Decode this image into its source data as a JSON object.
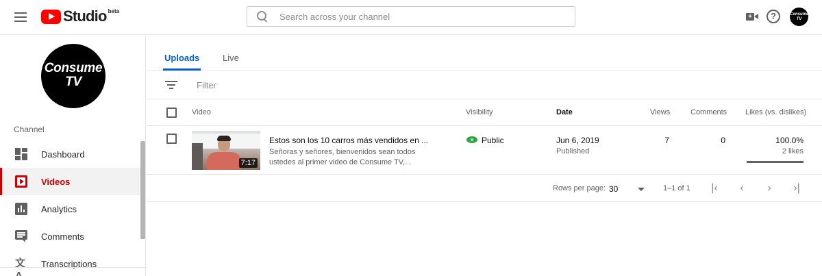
{
  "header": {
    "logo_text": "Studio",
    "logo_badge": "beta",
    "search_placeholder": "Search across your channel",
    "avatar_text": "Consume TV"
  },
  "sidebar": {
    "channel_avatar_line1": "Consume",
    "channel_avatar_line2": "TV",
    "section_label": "Channel",
    "items": [
      {
        "label": "Dashboard",
        "icon": "dashboard-icon"
      },
      {
        "label": "Videos",
        "icon": "videos-icon",
        "active": true
      },
      {
        "label": "Analytics",
        "icon": "analytics-icon"
      },
      {
        "label": "Comments",
        "icon": "comments-icon"
      },
      {
        "label": "Transcriptions",
        "icon": "transcriptions-icon"
      }
    ]
  },
  "main": {
    "tabs": [
      {
        "label": "Uploads",
        "active": true
      },
      {
        "label": "Live",
        "active": false
      }
    ],
    "filter_placeholder": "Filter",
    "columns": {
      "video": "Video",
      "visibility": "Visibility",
      "date": "Date",
      "views": "Views",
      "comments": "Comments",
      "likes": "Likes (vs. dislikes)"
    },
    "rows": [
      {
        "title": "Estos son los 10 carros más vendidos en ...",
        "description": "Señoras y señores, bienvenidos sean todos ustedes al primer video de Consume TV,...",
        "duration": "7:17",
        "visibility": "Public",
        "date": "Jun 6, 2019",
        "date_status": "Published",
        "views": "7",
        "comments": "0",
        "likes_percent": "100.0%",
        "likes_count": "2 likes",
        "likes_ratio": 1.0
      }
    ],
    "pagination": {
      "rows_per_page_label": "Rows per page:",
      "rows_per_page_value": "30",
      "range": "1–1 of 1"
    }
  },
  "colors": {
    "accent": "#065fd4",
    "brand": "#ff0000",
    "active_nav": "#cc0000",
    "public": "#2ba640"
  }
}
